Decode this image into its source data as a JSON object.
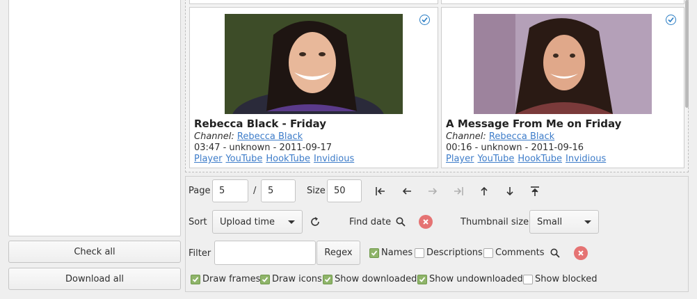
{
  "left_panel": {
    "check_all_label": "Check all",
    "download_all_label": "Download all"
  },
  "videos": [
    {
      "title": "Rebecca Black - Friday",
      "channel_label": "Channel:",
      "channel_name": "Rebecca Black",
      "meta": "03:47 - unknown - 2011-09-17",
      "links": [
        "Player",
        "YouTube",
        "HookTube",
        "Invidious"
      ],
      "checked": true
    },
    {
      "title": "A Message From Me on Friday",
      "channel_label": "Channel:",
      "channel_name": "Rebecca Black",
      "meta": "00:16 - unknown - 2011-09-16",
      "links": [
        "Player",
        "YouTube",
        "HookTube",
        "Invidious"
      ],
      "checked": true
    }
  ],
  "pagination": {
    "page_label": "Page",
    "page_value": "5",
    "separator": "/",
    "total_pages": "5",
    "size_label": "Size",
    "size_value": "50"
  },
  "sort": {
    "label": "Sort",
    "selected": "Upload time",
    "find_date_label": "Find date",
    "thumbnail_size_label": "Thumbnail size",
    "thumbnail_size_selected": "Small"
  },
  "filter": {
    "label": "Filter",
    "value": "",
    "regex_label": "Regex",
    "names_label": "Names",
    "names_checked": true,
    "descriptions_label": "Descriptions",
    "descriptions_checked": false,
    "comments_label": "Comments",
    "comments_checked": false
  },
  "display_options": [
    {
      "label": "Draw frames",
      "checked": true
    },
    {
      "label": "Draw icons",
      "checked": true
    },
    {
      "label": "Show downloaded",
      "checked": true
    },
    {
      "label": "Show undownloaded",
      "checked": true
    },
    {
      "label": "Show blocked",
      "checked": false
    }
  ],
  "colors": {
    "link": "#3d7cc9",
    "checkbox_on": "#8fb46a",
    "clear_button": "#e57373",
    "badge": "#2a7dc4"
  }
}
